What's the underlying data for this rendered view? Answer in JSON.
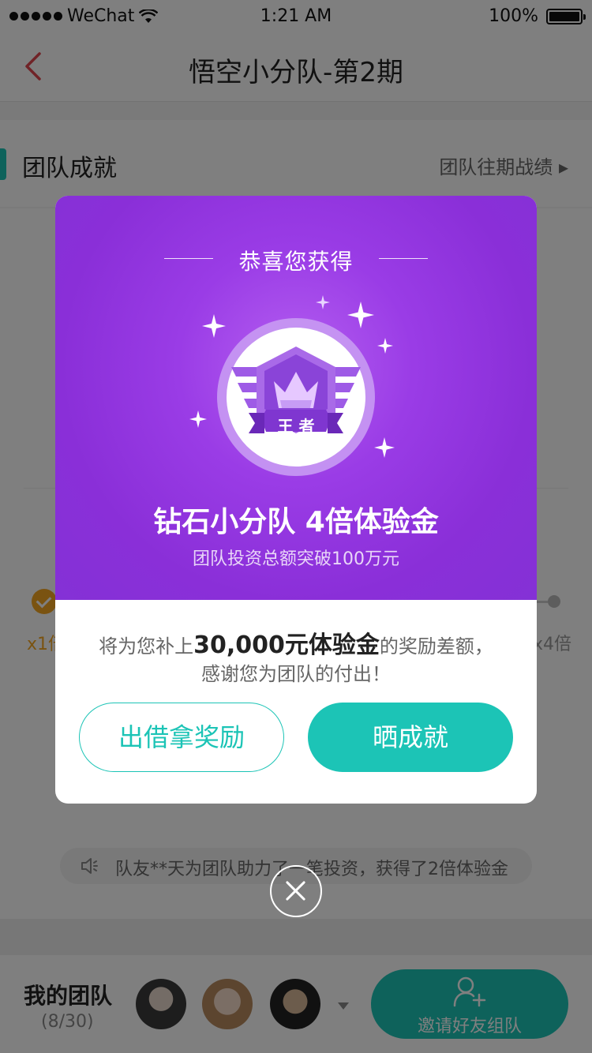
{
  "status_bar": {
    "carrier": "WeChat",
    "time": "1:21 AM",
    "battery": "100%"
  },
  "nav": {
    "title": "悟空小分队-第2期"
  },
  "section": {
    "title": "团队成就",
    "history_link": "团队往期战绩 ▸"
  },
  "progress": {
    "start_label": "x1倍",
    "end_label": "x4倍"
  },
  "notice": {
    "text": "队友**天为团队助力了一笔投资，获得了2倍体验金"
  },
  "team": {
    "title": "我的团队",
    "count": "(8/30)",
    "invite_label": "邀请好友组队"
  },
  "modal": {
    "congrats": "恭喜您获得",
    "badge_label": "王 者",
    "award_title": "钻石小分队 4倍体验金",
    "award_subtitle": "团队投资总额突破100万元",
    "reward_prefix": "将为您补上",
    "reward_amount": "30,000元体验金",
    "reward_suffix": "的奖励差额，",
    "reward_line2": "感谢您为团队的付出！",
    "btn_invest": "出借拿奖励",
    "btn_share": "晒成就"
  },
  "colors": {
    "accent": "#1cc4b6",
    "purple": "#8a2fd8",
    "gold": "#f5a623"
  }
}
